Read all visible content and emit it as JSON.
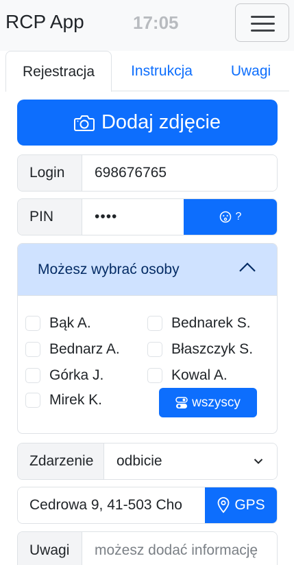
{
  "navbar": {
    "brand": "RCP App",
    "time": "17:05"
  },
  "tabs": [
    {
      "label": "Rejestracja",
      "active": true
    },
    {
      "label": "Instrukcja",
      "active": false
    },
    {
      "label": "Uwagi",
      "active": false
    }
  ],
  "photo_button": {
    "label": "Dodaj zdjęcie",
    "icon": "camera-icon"
  },
  "login": {
    "label": "Login",
    "value": "698676765"
  },
  "pin": {
    "label": "PIN",
    "value_masked": "••••",
    "help_label": "?",
    "help_icon": "face-icon"
  },
  "people": {
    "header": "Możesz wybrać osoby",
    "expanded": true,
    "items": [
      {
        "label": "Bąk A.",
        "checked": false
      },
      {
        "label": "Bednarek S.",
        "checked": false
      },
      {
        "label": "Bednarz A.",
        "checked": false
      },
      {
        "label": "Błaszczyk S.",
        "checked": false
      },
      {
        "label": "Górka J.",
        "checked": false
      },
      {
        "label": "Kowal A.",
        "checked": false
      },
      {
        "label": "Mirek K.",
        "checked": false
      }
    ],
    "all_button": "wszyscy"
  },
  "event": {
    "label": "Zdarzenie",
    "selected": "odbicie"
  },
  "address": {
    "value": "Cedrowa 9, 41-503 Cho",
    "gps_label": "GPS"
  },
  "notes": {
    "label": "Uwagi",
    "placeholder": "możesz dodać informację"
  },
  "colors": {
    "primary": "#0d6efd",
    "accordion_header": "#cfe2ff",
    "addon_bg": "#f3f4f6"
  }
}
